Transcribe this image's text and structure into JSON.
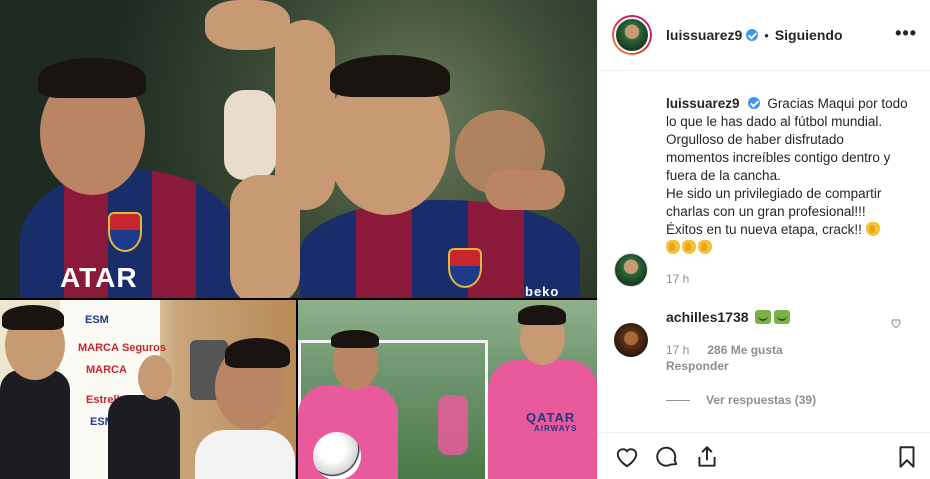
{
  "post": {
    "author": "luissuarez9",
    "follow_status": "Siguiendo",
    "more_label": "•••",
    "separator": "•"
  },
  "photos": {
    "top": {
      "crest_text": "",
      "sponsor": "ATAR",
      "sponsor2": "beko"
    },
    "bottom_left": {
      "board_labels": [
        "MARCA",
        "ESM",
        "Seguros",
        "MARCA",
        "ESM",
        "Estrella"
      ]
    },
    "bottom_right": {
      "sponsor": "QATAR",
      "sponsor_sub": "AIRWAYS"
    }
  },
  "caption": {
    "username": "luissuarez9",
    "lines": [
      "Gracias Maqui por todo",
      "lo que le has dado al fútbol mundial.",
      "Orgulloso de haber disfrutado",
      "momentos increíbles contigo dentro y",
      "fuera de la cancha.",
      "He sido un privilegiado de compartir",
      "charlas con un gran profesional!!!",
      "Éxitos en tu nueva etapa, crack!!"
    ],
    "time": "17 h"
  },
  "comment": {
    "username": "achilles1738",
    "time": "17 h",
    "likes": "286 Me gusta",
    "reply": "Responder",
    "view_replies": "Ver respuestas (39)"
  },
  "icons": {
    "like": "heart-icon",
    "comment": "comment-icon",
    "share": "share-icon",
    "save": "bookmark-icon"
  }
}
